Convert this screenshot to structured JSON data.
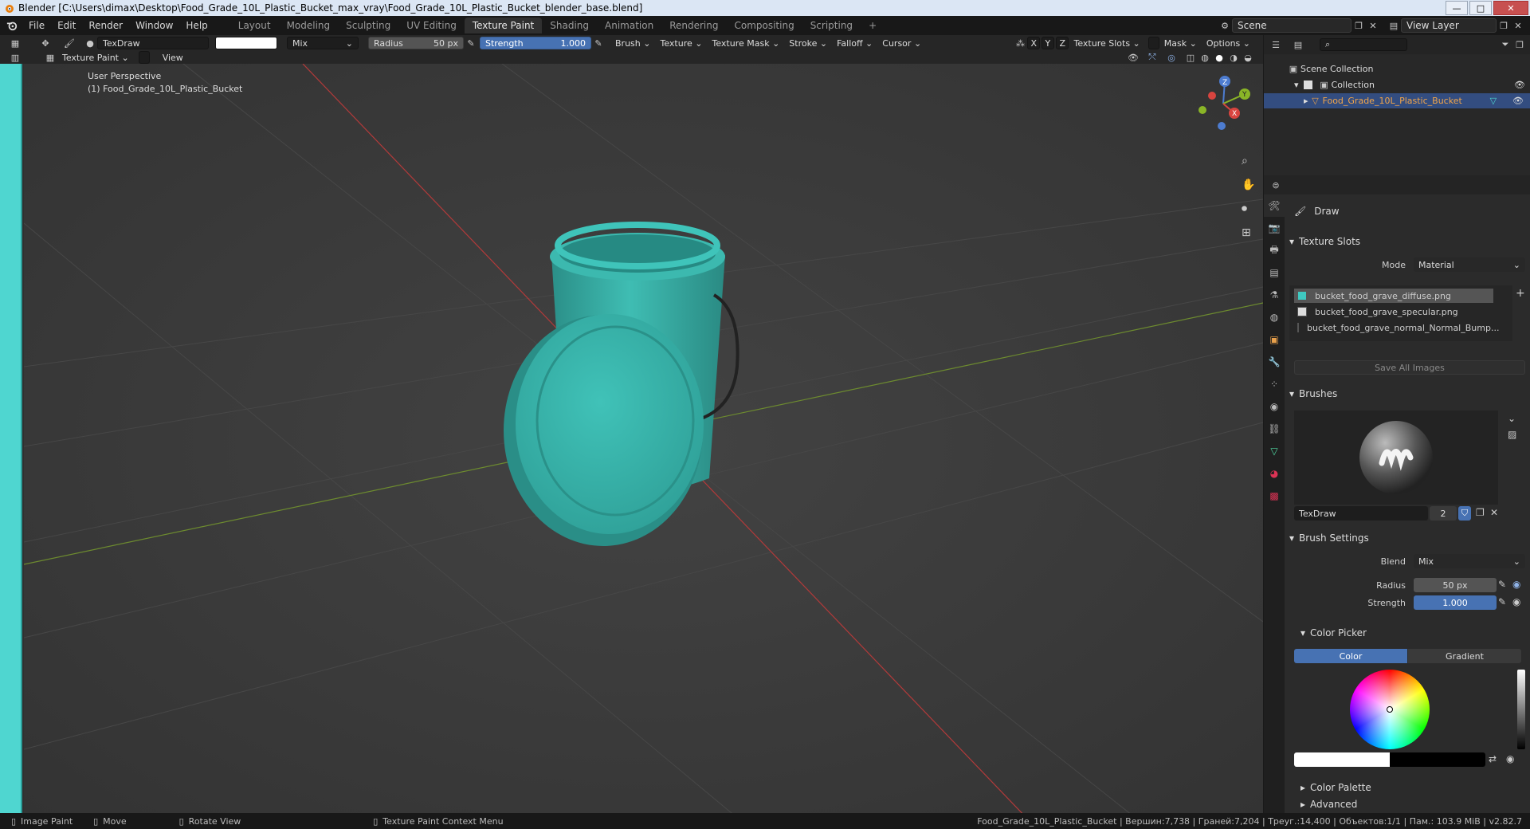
{
  "titlebar": {
    "title": "Blender [C:\\Users\\dimax\\Desktop\\Food_Grade_10L_Plastic_Bucket_max_vray\\Food_Grade_10L_Plastic_Bucket_blender_base.blend]",
    "min": "—",
    "max": "□",
    "close": "✕"
  },
  "menu": [
    "File",
    "Edit",
    "Render",
    "Window",
    "Help"
  ],
  "workspaces": [
    "Layout",
    "Modeling",
    "Sculpting",
    "UV Editing",
    "Texture Paint",
    "Shading",
    "Animation",
    "Rendering",
    "Compositing",
    "Scripting"
  ],
  "workspace_add": "+",
  "scene": {
    "label": "Scene",
    "view_layer": "View Layer"
  },
  "tool_header": {
    "brush_name": "TexDraw",
    "blend": "Mix",
    "radius_label": "Radius",
    "radius_value": "50 px",
    "strength_label": "Strength",
    "strength_value": "1.000",
    "menus": [
      "Brush",
      "Texture",
      "Texture Mask",
      "Stroke",
      "Falloff",
      "Cursor"
    ],
    "axes": [
      "X",
      "Y",
      "Z"
    ],
    "right_menus": [
      "Texture Slots",
      "Mask",
      "Options"
    ],
    "mode": "Texture Paint",
    "view": "View"
  },
  "viewport": {
    "perspective": "User Perspective",
    "object_line": "(1) Food_Grade_10L_Plastic_Bucket",
    "gizmo": {
      "z": "Z",
      "y": "Y",
      "x": "X"
    }
  },
  "outliner": {
    "root": "Scene Collection",
    "collection": "Collection",
    "object": "Food_Grade_10L_Plastic_Bucket"
  },
  "properties": {
    "tool_name": "Draw",
    "texture_slots": {
      "header": "Texture Slots",
      "mode_label": "Mode",
      "mode_value": "Material",
      "slots": [
        {
          "name": "bucket_food_grave_diffuse.png",
          "color": "#3fc9c1"
        },
        {
          "name": "bucket_food_grave_specular.png",
          "color": "#dcdcdc"
        },
        {
          "name": "bucket_food_grave_normal_Normal_Bump...",
          "color": "#b6b8ff"
        }
      ],
      "save_all": "Save All Images"
    },
    "brushes": {
      "header": "Brushes",
      "name": "TexDraw",
      "users": "2"
    },
    "brush_settings": {
      "header": "Brush Settings",
      "blend_label": "Blend",
      "blend_value": "Mix",
      "radius_label": "Radius",
      "radius_value": "50 px",
      "strength_label": "Strength",
      "strength_value": "1.000"
    },
    "color_picker": {
      "header": "Color Picker",
      "tab_color": "Color",
      "tab_gradient": "Gradient"
    },
    "color_palette": "Color Palette",
    "advanced": "Advanced"
  },
  "statusbar": {
    "items": [
      "Image Paint",
      "Move",
      "Rotate View",
      "Texture Paint Context Menu"
    ],
    "stats": "Food_Grade_10L_Plastic_Bucket | Вершин:7,738 | Граней:7,204 | Треуг.:14,400 | Объектов:1/1 | Пам.: 103.9 MiB | v2.82.7"
  },
  "colors": {
    "accent": "#4772b3",
    "bucket": "#3bb7ad",
    "header_bg": "#262626",
    "viewport_bg": "#3d3d3d",
    "side_strip": "#4fd6d0"
  }
}
